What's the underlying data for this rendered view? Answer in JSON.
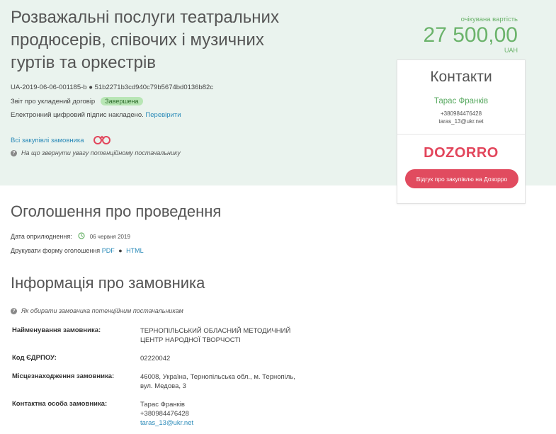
{
  "header": {
    "title": "Розважальні послуги театральних продюсерів, співочих і музичних гуртів та оркестрів",
    "tender_id": "UA-2019-06-06-001185-b",
    "tender_hash": "51b2271b3cd940c79b5674bd0136b82c",
    "report_label": "Звіт про укладений договір",
    "status_badge": "Завершена",
    "signature_text": "Електронний цифровий підпис накладено.",
    "verify_link": "Перевірити",
    "all_purchases_link": "Всі закупівлі замовника",
    "attention_notice": "На що звернути увагу потенційному постачальнику"
  },
  "expected_value": {
    "label": "очікувана вартість",
    "amount": "27 500,00",
    "currency": "UAH"
  },
  "contacts": {
    "title": "Контакти",
    "name": "Тарас Франків",
    "phone": "+380984476428",
    "email": "taras_13@ukr.net",
    "dozorro_logo": "DOZORRO",
    "dozorro_button": "Відгук про закупівлю на Дозорро"
  },
  "announcement": {
    "title": "Оголошення про проведення",
    "publish_label": "Дата оприлюднення:",
    "publish_date": "06 червня 2019",
    "print_label": "Друкувати форму оголошення",
    "pdf_link": "PDF",
    "html_link": "HTML"
  },
  "customer": {
    "title": "Інформація про замовника",
    "notice": "Як обирати замовника потенційним постачальникам",
    "rows": [
      {
        "label": "Найменування замовника:",
        "lines": [
          "ТЕРНОПІЛЬСЬКИЙ ОБЛАСНИЙ МЕТОДИЧНИЙ",
          "ЦЕНТР НАРОДНОЇ ТВОРЧОСТІ"
        ]
      },
      {
        "label": "Код ЄДРПОУ:",
        "lines": [
          "02220042"
        ]
      },
      {
        "label": "Місцезнаходження замовника:",
        "lines": [
          "46008, Україна, Тернопільська обл., м. Тернопіль,",
          "вул. Медова, 3"
        ]
      },
      {
        "label": "Контактна особа замовника:",
        "lines": [
          "Тарас Франків",
          "+380984476428",
          "taras_13@ukr.net"
        ]
      }
    ]
  }
}
